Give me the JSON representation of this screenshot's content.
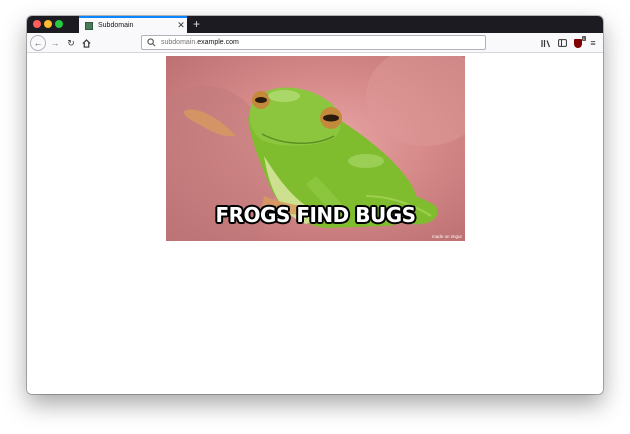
{
  "browser": {
    "tab": {
      "title": "Subdomain",
      "close_glyph": "✕"
    },
    "new_tab_glyph": "+",
    "url": {
      "subdomain": "subdomain.",
      "host": "example.com"
    },
    "ublock_badge": "1",
    "icons": {
      "back": "arrow-left-icon",
      "forward": "arrow-right-icon",
      "reload": "reload-icon",
      "home": "home-icon",
      "search": "search-icon",
      "library": "library-icon",
      "sidebar": "sidebar-icon",
      "ublock": "ublock-origin-icon",
      "menu": "hamburger-menu-icon"
    },
    "colors": {
      "tab_accent": "#0a84ff",
      "tabstrip_bg": "#1c1b22",
      "toolbar_bg": "#f9f9fb"
    }
  },
  "page": {
    "meme": {
      "caption": "FROGS FIND BUGS",
      "watermark": "made on imgur"
    }
  }
}
